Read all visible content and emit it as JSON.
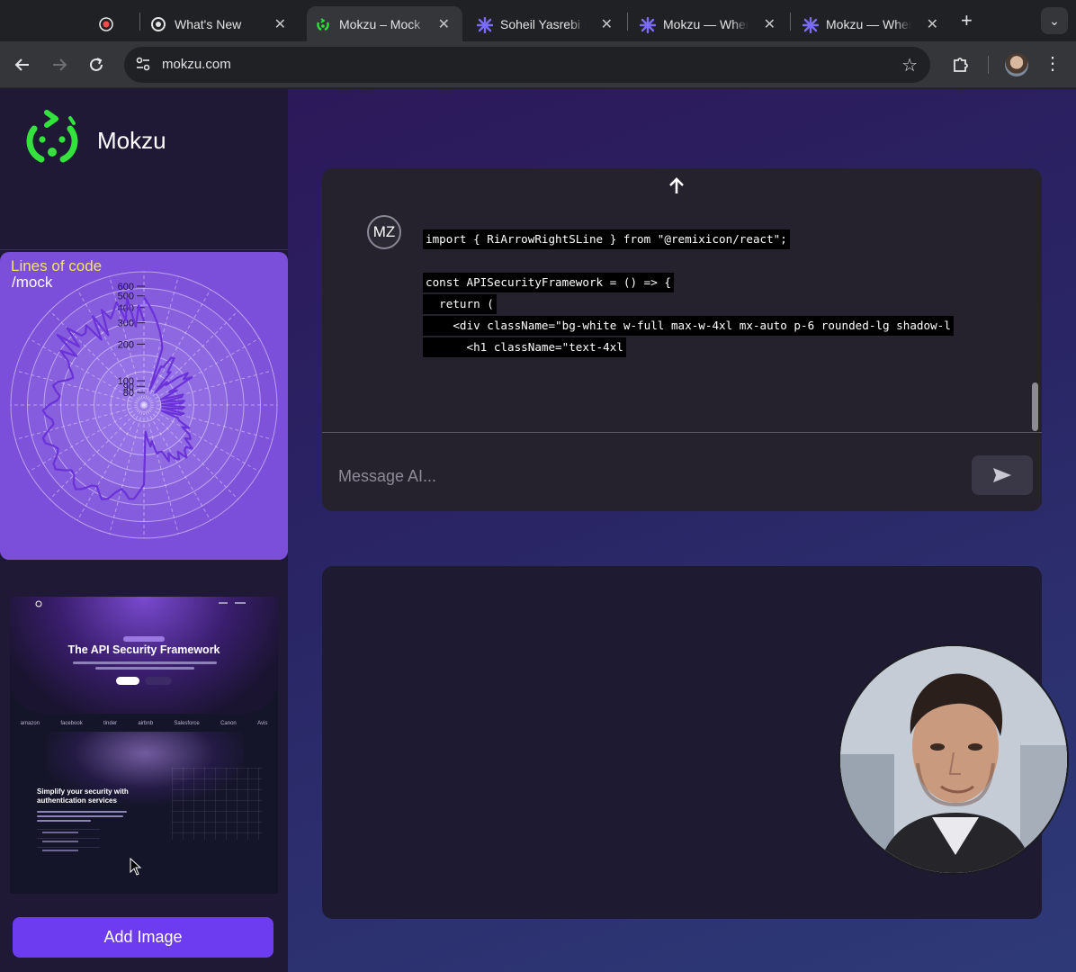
{
  "browser": {
    "tabs": [
      {
        "title": "",
        "icon": "record-icon"
      },
      {
        "title": "What's New",
        "icon": "chrome-icon"
      },
      {
        "title": "Mokzu – Mock",
        "icon": "mokzu-icon"
      },
      {
        "title": "Soheil Yasrebi |",
        "icon": "asterisk-icon"
      },
      {
        "title": "Mokzu — Wher",
        "icon": "asterisk-icon"
      },
      {
        "title": "Mokzu — Wher",
        "icon": "asterisk-icon"
      }
    ],
    "url": "mokzu.com"
  },
  "sidebar": {
    "brand": "Mokzu",
    "add_image_label": "Add Image"
  },
  "chart_data": {
    "type": "polar",
    "title": "Lines of code",
    "subtitle": "/mock",
    "radial_ticks": [
      80,
      90,
      100,
      200,
      300,
      400,
      500,
      600
    ],
    "colors": {
      "background": "#7b4fd9",
      "line": "#6a32d8",
      "title": "#f3e26a"
    }
  },
  "thumbnail": {
    "heading": "The API Security Framework",
    "logos": [
      "amazon",
      "facebook",
      "tinder",
      "airbnb",
      "Salesforce",
      "Canon",
      "Avis"
    ],
    "section_heading": "Simplify your security with authentication services"
  },
  "chat": {
    "avatar_initials": "MZ",
    "code_lines": [
      "import { RiArrowRightSLine } from \"@remixicon/react\";",
      "",
      "const APISecurityFramework = () => {",
      "  return (",
      "    <div className=\"bg-white w-full max-w-4xl mx-auto p-6 rounded-lg shadow-l",
      "      <h1 className=\"text-4xl"
    ],
    "input_placeholder": "Message AI..."
  }
}
